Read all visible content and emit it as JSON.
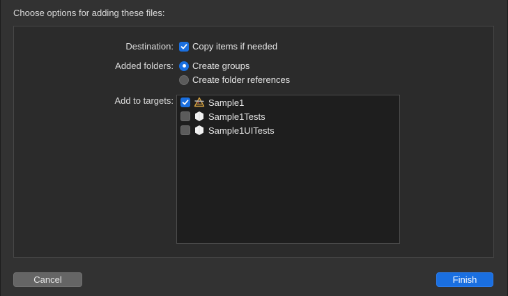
{
  "dialog": {
    "title": "Choose options for adding these files:"
  },
  "destination": {
    "label": "Destination:",
    "option_label": "Copy items if needed",
    "checked": true
  },
  "added_folders": {
    "label": "Added folders:",
    "options": [
      {
        "label": "Create groups",
        "selected": true
      },
      {
        "label": "Create folder references",
        "selected": false
      }
    ]
  },
  "targets": {
    "label": "Add to targets:",
    "items": [
      {
        "name": "Sample1",
        "checked": true,
        "icon": "app-icon"
      },
      {
        "name": "Sample1Tests",
        "checked": false,
        "icon": "test-bundle-icon"
      },
      {
        "name": "Sample1UITests",
        "checked": false,
        "icon": "test-bundle-icon"
      }
    ]
  },
  "buttons": {
    "cancel_label": "Cancel",
    "finish_label": "Finish"
  },
  "colors": {
    "accent": "#1a6fe0",
    "background": "#323232",
    "panel": "#2b2b2b",
    "list_background": "#1e1e1e"
  }
}
